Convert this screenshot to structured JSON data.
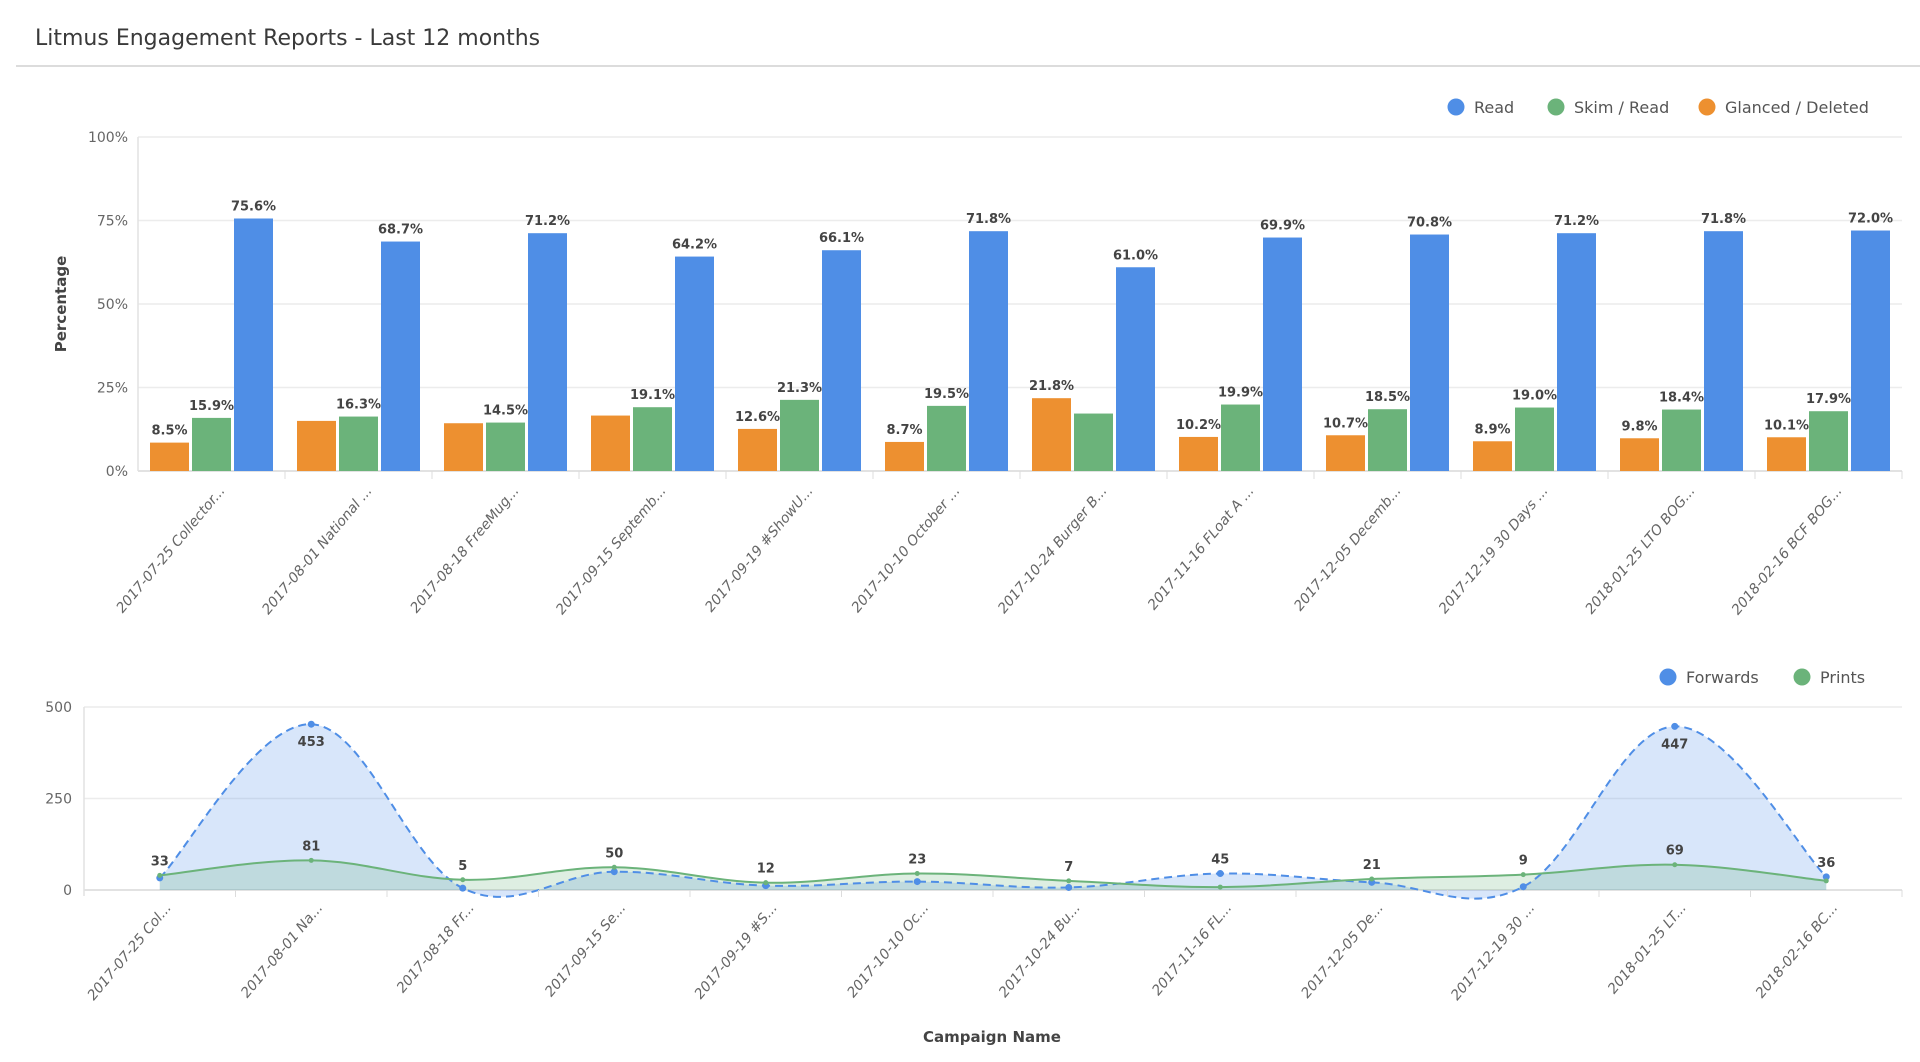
{
  "header": {
    "title": "Litmus Engagement Reports - Last 12 months"
  },
  "chart_data": [
    {
      "type": "bar",
      "title": "",
      "xlabel": "",
      "ylabel": "Percentage",
      "ylim": [
        0,
        100
      ],
      "yticks": [
        "0%",
        "25%",
        "50%",
        "75%",
        "100%"
      ],
      "grid": true,
      "legend_position": "top-right",
      "categories": [
        "2017-07-25 Collector...",
        "2017-08-01 National ...",
        "2017-08-18 FreeMug...",
        "2017-09-15 Septemb...",
        "2017-09-19 #ShowU...",
        "2017-10-10 October ...",
        "2017-10-24 Burger B...",
        "2017-11-16 FLoat A ...",
        "2017-12-05 Decemb...",
        "2017-12-19 30 Days ...",
        "2018-01-25 LTO BOG...",
        "2018-02-16 BCF BOG..."
      ],
      "series": [
        {
          "name": "Glanced / Deleted",
          "color": "#ED9030",
          "values": [
            8.5,
            15.0,
            14.3,
            16.6,
            12.6,
            8.7,
            21.8,
            10.2,
            10.7,
            8.9,
            9.8,
            10.1
          ],
          "labels": [
            "8.5%",
            "",
            "",
            "",
            "12.6%",
            "8.7%",
            "21.8%",
            "10.2%",
            "10.7%",
            "8.9%",
            "9.8%",
            "10.1%"
          ]
        },
        {
          "name": "Skim / Read",
          "color": "#6BB37A",
          "values": [
            15.9,
            16.3,
            14.5,
            19.1,
            21.3,
            19.5,
            17.2,
            19.9,
            18.5,
            19.0,
            18.4,
            17.9
          ],
          "labels": [
            "15.9%",
            "16.3%",
            "14.5%",
            "19.1%",
            "21.3%",
            "19.5%",
            "",
            "19.9%",
            "18.5%",
            "19.0%",
            "18.4%",
            "17.9%"
          ]
        },
        {
          "name": "Read",
          "color": "#4F8EE6",
          "values": [
            75.6,
            68.7,
            71.2,
            64.2,
            66.1,
            71.8,
            61.0,
            69.9,
            70.8,
            71.2,
            71.8,
            72.0
          ],
          "labels": [
            "75.6%",
            "68.7%",
            "71.2%",
            "64.2%",
            "66.1%",
            "71.8%",
            "61.0%",
            "69.9%",
            "70.8%",
            "71.2%",
            "71.8%",
            "72.0%"
          ]
        }
      ],
      "legend": [
        "Read",
        "Skim / Read",
        "Glanced / Deleted"
      ]
    },
    {
      "type": "area",
      "title": "",
      "xlabel": "Campaign Name",
      "ylabel": "",
      "ylim": [
        0,
        500
      ],
      "yticks": [
        "0",
        "250",
        "500"
      ],
      "grid": true,
      "legend_position": "top-right",
      "categories": [
        "2017-07-25 Col...",
        "2017-08-01 Na...",
        "2017-08-18 Fr...",
        "2017-09-15 Se...",
        "2017-09-19 #S...",
        "2017-10-10 Oc...",
        "2017-10-24 Bu...",
        "2017-11-16 FL...",
        "2017-12-05 De...",
        "2017-12-19 30 ...",
        "2018-01-25 LT...",
        "2018-02-16 BC..."
      ],
      "series": [
        {
          "name": "Forwards",
          "color": "#4F8EE6",
          "style": "dashed",
          "values": [
            33,
            453,
            5,
            50,
            12,
            23,
            7,
            45,
            21,
            9,
            447,
            36
          ],
          "labels": [
            "33",
            "453",
            "5",
            "50",
            "12",
            "23",
            "7",
            "45",
            "21",
            "9",
            "447",
            "36"
          ]
        },
        {
          "name": "Prints",
          "color": "#6BB37A",
          "style": "solid",
          "values": [
            40,
            81,
            28,
            62,
            20,
            45,
            25,
            8,
            30,
            42,
            69,
            25
          ],
          "labels": [
            "",
            "81",
            "",
            "",
            "",
            "",
            "",
            "",
            "",
            "",
            "69",
            ""
          ]
        }
      ],
      "legend": [
        "Forwards",
        "Prints"
      ]
    }
  ]
}
